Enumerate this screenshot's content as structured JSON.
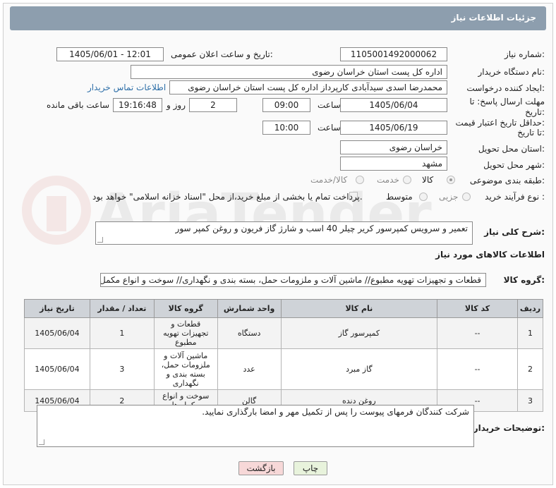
{
  "header": {
    "title": "جزئیات اطلاعات نیاز"
  },
  "fields": {
    "need_number_label": "شماره نیاز:",
    "need_number": "1105001492000062",
    "announce_label": "تاریخ و ساعت اعلان عمومی:",
    "announce_value": "1405/06/01 - 12:01",
    "buyer_label": "نام دستگاه خریدار:",
    "buyer_value": "اداره کل پست استان خراسان رضوی",
    "creator_label": "ایجاد کننده درخواست:",
    "creator_value": "محمدرضا اسدی سیدآبادی کارپرداز اداره کل پست استان خراسان رضوی",
    "contact_link": "اطلاعات تماس خریدار",
    "deadline_label_1": "مهلت ارسال پاسخ: تا",
    "deadline_label_2": "تاریخ:",
    "deadline_date": "1405/06/04",
    "time_label": "ساعت",
    "deadline_time": "09:00",
    "days_value": "2",
    "days_label": "روز و",
    "remaining_time": "19:16:48",
    "remaining_label": "ساعت باقی مانده",
    "validity_label_1": "حداقل تاریخ اعتبار قیمت:",
    "validity_label_2": "تا تاریخ:",
    "validity_date": "1405/06/19",
    "validity_time_label": "ساعت",
    "validity_time": "10:00",
    "province_label": "استان محل تحویل:",
    "province_value": "خراسان رضوی",
    "city_label": "شهر محل تحویل:",
    "city_value": "مشهد",
    "category_label": "طبقه بندی موضوعی:",
    "category_options": [
      "کالا",
      "خدمت",
      "کالا/خدمت"
    ],
    "process_label": "نوع فرآیند خرید :",
    "process_options": [
      "جزیی",
      "متوسط"
    ],
    "payment_text": "پرداخت تمام یا بخشی از مبلغ خرید،از محل \"اسناد خزانه اسلامی\" خواهد بود."
  },
  "description": {
    "label": "شرح کلی نیاز:",
    "value": "تعمیر و سرویس کمپرسور کریر چیلر 40 اسب و شارژ گاز فریون و روغن کمپر سور"
  },
  "goods_info": {
    "title": "اطلاعات کالاهای مورد نیاز",
    "group_label": "گروه کالا:",
    "group_value": "قطعات و تجهیزات تهویه مطبوع//  ماشین آلات و ملزومات حمل، بسته بندی و نگهداری//  سوخت و انواع مکمل ها"
  },
  "table": {
    "headers": [
      "ردیف",
      "کد کالا",
      "نام کالا",
      "واحد شمارش",
      "گروه کالا",
      "تعداد / مقدار",
      "تاریخ نیاز"
    ],
    "rows": [
      [
        "1",
        "--",
        "کمپرسور گاز",
        "دستگاه",
        "قطعات و تجهیزات تهویه مطبوع",
        "1",
        "1405/06/04"
      ],
      [
        "2",
        "--",
        "گاز مبرد",
        "عدد",
        "ماشین آلات و ملزومات حمل، بسته بندی و نگهداری",
        "3",
        "1405/06/04"
      ],
      [
        "3",
        "--",
        "روغن دنده",
        "گالن",
        "سوخت و انواع مکمل ها",
        "2",
        "1405/06/04"
      ]
    ]
  },
  "buyer_notes": {
    "label": "توضیحات خریدار:",
    "value": "شرکت کنندگان فرمهای پیوست را پس از تکمیل مهر و امضا بارگذاری نمایید."
  },
  "buttons": {
    "print": "چاپ",
    "back": "بازگشت"
  },
  "watermark": "AriaTender.net",
  "colors": {
    "header_bg": "#8d9eae",
    "link": "#2e6fa8",
    "back_btn_bg": "#f7d8d8",
    "print_btn_bg": "#e8f3dc"
  }
}
